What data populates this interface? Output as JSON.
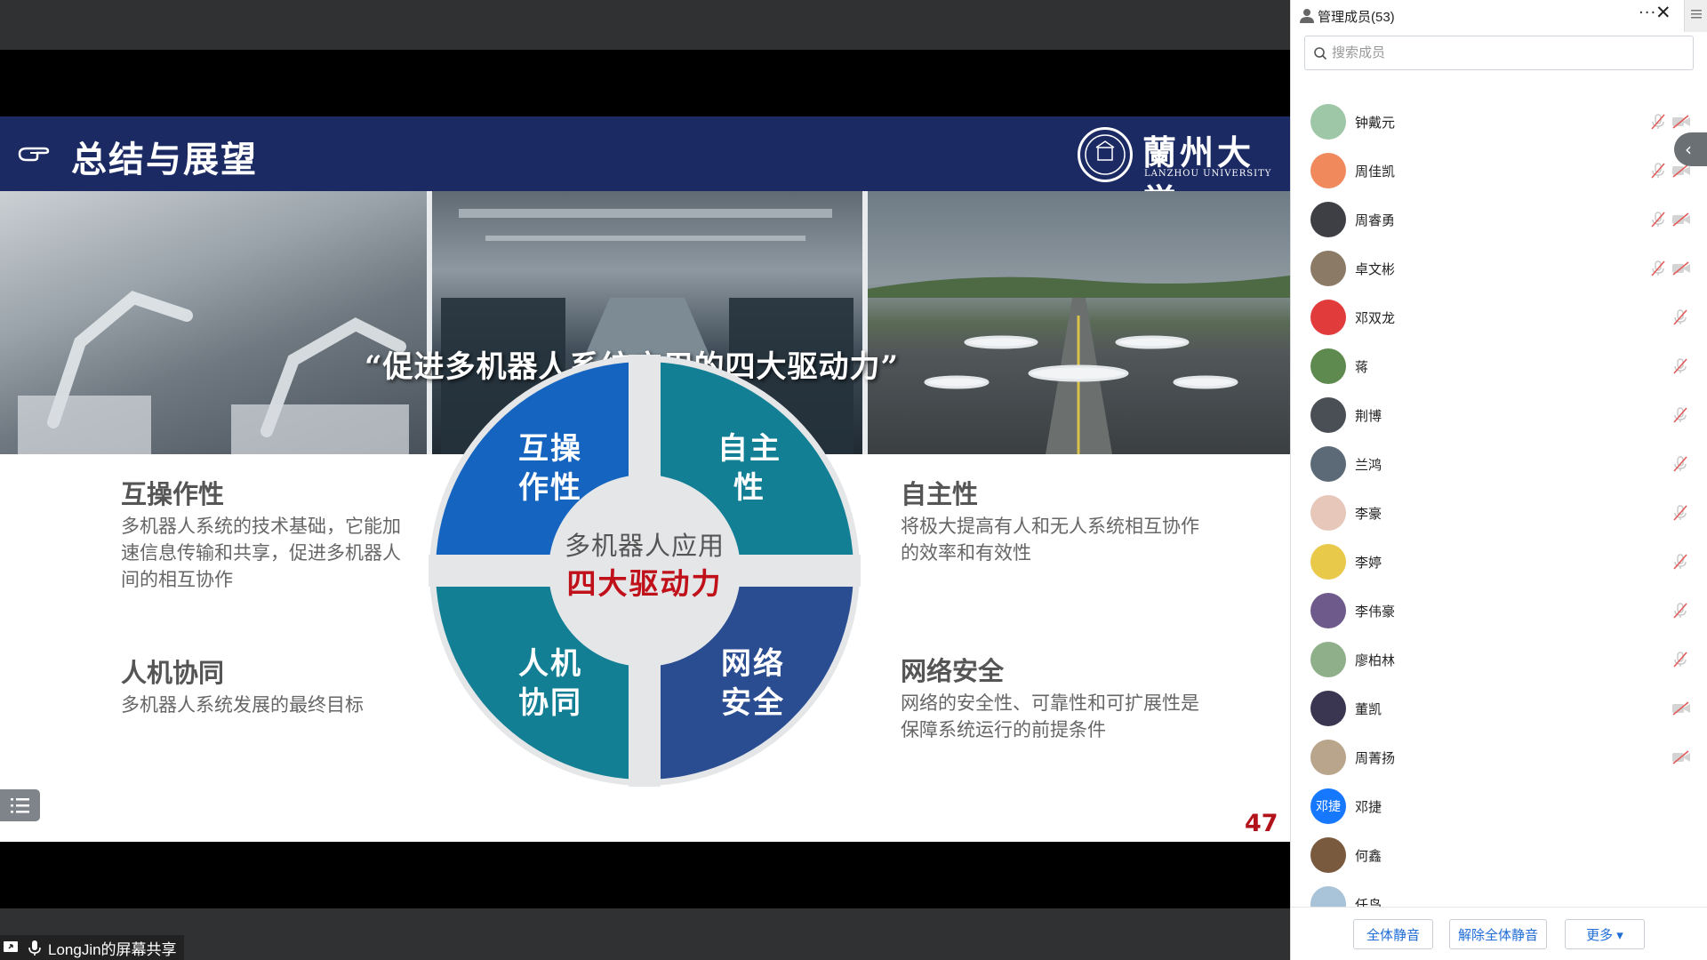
{
  "slide": {
    "title": "总结与展望",
    "university_name": "蘭州大学",
    "university_en": "LANZHOU UNIVERSITY",
    "quote": "“促进多机器人系统应用的四大驱动力”",
    "wheel": {
      "top_left": "互操\n作性",
      "top_right": "自主\n性",
      "bottom_left": "人机\n协同",
      "bottom_right": "网络\n安全",
      "center_top": "多机器人应用",
      "center_bottom": "四大驱动力",
      "colors": {
        "top_left": "#1565c0",
        "top_right": "#127f95",
        "bottom_left": "#127f95",
        "bottom_right": "#2a4d92",
        "center_accent": "#c0101a"
      }
    },
    "features": {
      "interop": {
        "title": "互操作性",
        "desc": "多机器人系统的技术基础，它能加速信息传输和共享，促进多机器人间的相互协作"
      },
      "hrc": {
        "title": "人机协同",
        "desc": "多机器人系统发展的最终目标"
      },
      "autonomy": {
        "title": "自主性",
        "desc": "将极大提高有人和无人系统相互协作的效率和有效性"
      },
      "security": {
        "title": "网络安全",
        "desc": "网络的安全性、可靠性和可扩展性是保障系统运行的前提条件"
      }
    },
    "page_number": "47"
  },
  "share": {
    "label": "LongJin的屏幕共享"
  },
  "panel": {
    "title": "管理成员(53)",
    "more_glyph": "···",
    "close_glyph": "✕",
    "search_placeholder": "搜索成员",
    "members": [
      {
        "name": "钟戴元",
        "avatar_color": "#9ec7a8",
        "avatar_text": "",
        "mic": "muted",
        "cam": "off"
      },
      {
        "name": "周佳凯",
        "avatar_color": "#f08a5d",
        "avatar_text": "",
        "mic": "muted",
        "cam": "off"
      },
      {
        "name": "周睿勇",
        "avatar_color": "#3d3f45",
        "avatar_text": "",
        "mic": "muted",
        "cam": "off"
      },
      {
        "name": "卓文彬",
        "avatar_color": "#8a7a66",
        "avatar_text": "",
        "mic": "muted",
        "cam": "off"
      },
      {
        "name": "邓双龙",
        "avatar_color": "#e23b3b",
        "avatar_text": "",
        "mic": "muted",
        "cam": ""
      },
      {
        "name": "蒋",
        "avatar_color": "#5f8a4f",
        "avatar_text": "",
        "mic": "muted",
        "cam": ""
      },
      {
        "name": "荆博",
        "avatar_color": "#4a4f55",
        "avatar_text": "",
        "mic": "muted",
        "cam": ""
      },
      {
        "name": "兰鸿",
        "avatar_color": "#5c6a78",
        "avatar_text": "",
        "mic": "muted",
        "cam": ""
      },
      {
        "name": "李豪",
        "avatar_color": "#e6c7b9",
        "avatar_text": "",
        "mic": "muted",
        "cam": ""
      },
      {
        "name": "李婷",
        "avatar_color": "#e8c94a",
        "avatar_text": "",
        "mic": "muted",
        "cam": ""
      },
      {
        "name": "李伟豪",
        "avatar_color": "#6f5a8c",
        "avatar_text": "",
        "mic": "muted",
        "cam": ""
      },
      {
        "name": "廖柏林",
        "avatar_color": "#8fae8a",
        "avatar_text": "",
        "mic": "muted",
        "cam": ""
      },
      {
        "name": "董凯",
        "avatar_color": "#3a3550",
        "avatar_text": "",
        "mic": "",
        "cam": "off"
      },
      {
        "name": "周菁扬",
        "avatar_color": "#b9a48c",
        "avatar_text": "",
        "mic": "",
        "cam": "off"
      },
      {
        "name": "邓捷",
        "avatar_color": "#1677ff",
        "avatar_text": "邓捷",
        "mic": "",
        "cam": ""
      },
      {
        "name": "何鑫",
        "avatar_color": "#7a5a3f",
        "avatar_text": "",
        "mic": "",
        "cam": ""
      },
      {
        "name": "任鸟",
        "avatar_color": "#a9c4d9",
        "avatar_text": "",
        "mic": "",
        "cam": ""
      }
    ],
    "footer": {
      "mute_all": "全体静音",
      "unmute_all": "解除全体静音",
      "more": "更多 ▾"
    }
  }
}
